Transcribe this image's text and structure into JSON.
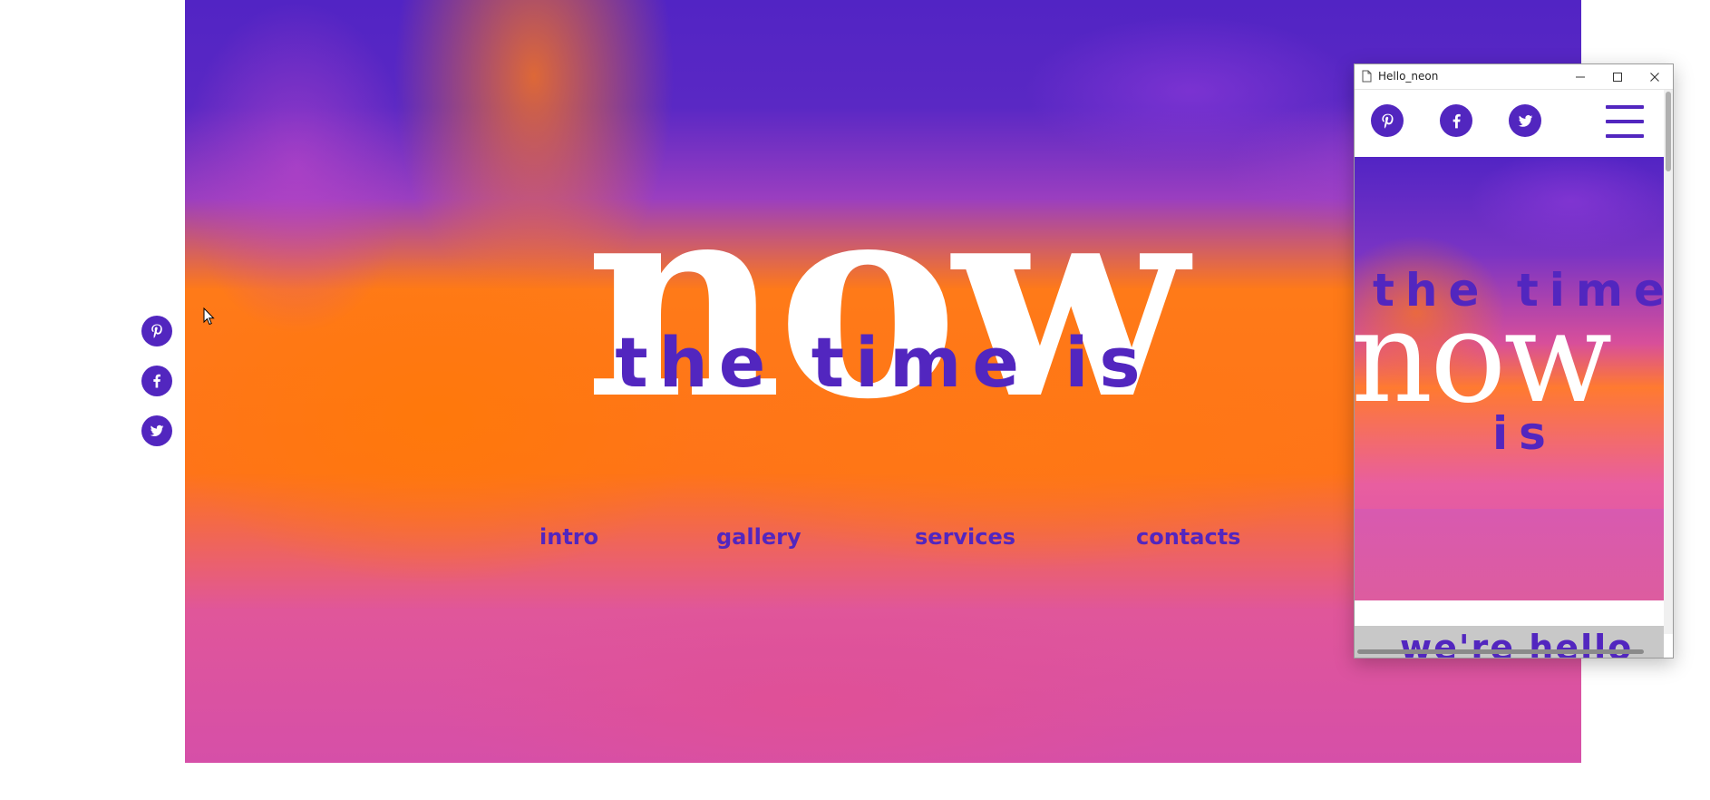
{
  "hero": {
    "big_word": "now",
    "tagline": "the time is"
  },
  "nav": {
    "items": [
      {
        "label": "intro"
      },
      {
        "label": "gallery"
      },
      {
        "label": "services"
      },
      {
        "label": "contacts"
      }
    ]
  },
  "social": {
    "icons": [
      "pinterest-icon",
      "facebook-icon",
      "twitter-icon"
    ]
  },
  "popup": {
    "title": "Hello_neon",
    "hero_top": "the time",
    "hero_big": "now",
    "hero_bottom": "is",
    "next_section": "we're hello"
  },
  "colors": {
    "brand_purple": "#5226bf",
    "accent_orange": "#ff7a18",
    "accent_pink": "#d64fa8"
  }
}
